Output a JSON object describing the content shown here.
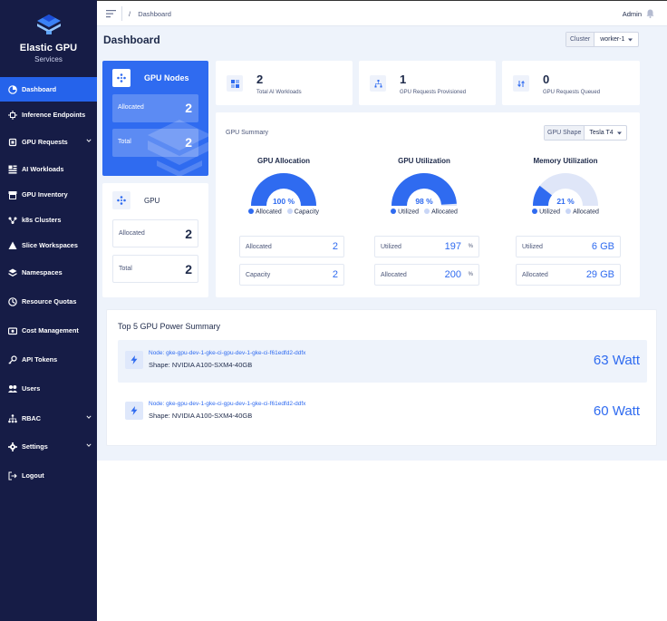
{
  "brand": {
    "title": "Elastic GPU",
    "subtitle": "Services"
  },
  "sidebar": {
    "items": [
      {
        "label": "Dashboard",
        "icon": "pie-chart-icon",
        "active": true,
        "caret": false
      },
      {
        "label": "Inference Endpoints",
        "icon": "endpoint-icon",
        "active": false,
        "caret": false
      },
      {
        "label": "GPU Requests",
        "icon": "chip-icon",
        "active": false,
        "caret": true
      },
      {
        "label": "AI Workloads",
        "icon": "grid-icon",
        "active": false,
        "caret": false
      },
      {
        "label": "GPU Inventory",
        "icon": "inventory-icon",
        "active": false,
        "caret": false
      },
      {
        "label": "k8s Clusters",
        "icon": "cluster-icon",
        "active": false,
        "caret": false
      },
      {
        "label": "Slice Workspaces",
        "icon": "triangle-icon",
        "active": false,
        "caret": false
      },
      {
        "label": "Namespaces",
        "icon": "layers-icon",
        "active": false,
        "caret": false
      },
      {
        "label": "Resource Quotas",
        "icon": "quota-icon",
        "active": false,
        "caret": false
      },
      {
        "label": "Cost Management",
        "icon": "cost-icon",
        "active": false,
        "caret": false
      },
      {
        "label": "API Tokens",
        "icon": "key-icon",
        "active": false,
        "caret": false
      },
      {
        "label": "Users",
        "icon": "users-icon",
        "active": false,
        "caret": false
      },
      {
        "label": "RBAC",
        "icon": "rbac-icon",
        "active": false,
        "caret": true
      },
      {
        "label": "Settings",
        "icon": "gear-icon",
        "active": false,
        "caret": true
      },
      {
        "label": "Logout",
        "icon": "logout-icon",
        "active": false,
        "caret": false
      }
    ]
  },
  "topbar": {
    "breadcrumb_sep": "/",
    "breadcrumb": "Dashboard",
    "user": "Admin"
  },
  "page": {
    "title": "Dashboard"
  },
  "cluster": {
    "label": "Cluster",
    "value": "worker-1"
  },
  "gpu_nodes": {
    "title": "GPU Nodes",
    "allocated_label": "Allocated",
    "allocated_value": "2",
    "total_label": "Total",
    "total_value": "2"
  },
  "gpu": {
    "title": "GPU",
    "allocated_label": "Allocated",
    "allocated_value": "2",
    "total_label": "Total",
    "total_value": "2"
  },
  "stats": [
    {
      "value": "2",
      "label": "Total AI Workloads",
      "icon": "workloads-icon"
    },
    {
      "value": "1",
      "label": "GPU Requests Provisioned",
      "icon": "hierarchy-icon"
    },
    {
      "value": "0",
      "label": "GPU Requests Queued",
      "icon": "queue-icon"
    }
  ],
  "summary": {
    "title": "GPU Summary",
    "shape_label": "GPU Shape",
    "shape_value": "Tesla T4",
    "gauges": [
      {
        "title": "GPU Allocation",
        "percent_label": "100 %",
        "fraction": 1.0,
        "legend": [
          "Allocated",
          "Capacity"
        ],
        "rows": [
          {
            "label": "Allocated",
            "value": "2",
            "unit": ""
          },
          {
            "label": "Capacity",
            "value": "2",
            "unit": ""
          }
        ]
      },
      {
        "title": "GPU Utilization",
        "percent_label": "98 %",
        "fraction": 0.98,
        "legend": [
          "Utilized",
          "Allocated"
        ],
        "rows": [
          {
            "label": "Utilized",
            "value": "197",
            "unit": "%"
          },
          {
            "label": "Allocated",
            "value": "200",
            "unit": "%"
          }
        ]
      },
      {
        "title": "Memory Utilization",
        "percent_label": "21 %",
        "fraction": 0.21,
        "legend": [
          "Utilized",
          "Allocated"
        ],
        "rows": [
          {
            "label": "Utilized",
            "value": "6 GB",
            "unit": ""
          },
          {
            "label": "Allocated",
            "value": "29 GB",
            "unit": ""
          }
        ]
      }
    ]
  },
  "power": {
    "title": "Top 5 GPU Power Summary",
    "items": [
      {
        "node": "Node: gke-gpu-dev-1-gke-ci-gpu-dev-1-gke-ci-f61edfd2-ddfx",
        "shape": "Shape: NVIDIA A100-SXM4-40GB",
        "watt": "63 Watt"
      },
      {
        "node": "Node: gke-gpu-dev-1-gke-ci-gpu-dev-1-gke-ci-f61edfd2-ddfx",
        "shape": "Shape: NVIDIA A100-SXM4-40GB",
        "watt": "60 Watt"
      }
    ]
  },
  "colors": {
    "sidebar": "#161c46",
    "accent": "#2f6bf0",
    "gauge_track": "#dfe6f8",
    "background": "#eef3fb"
  }
}
